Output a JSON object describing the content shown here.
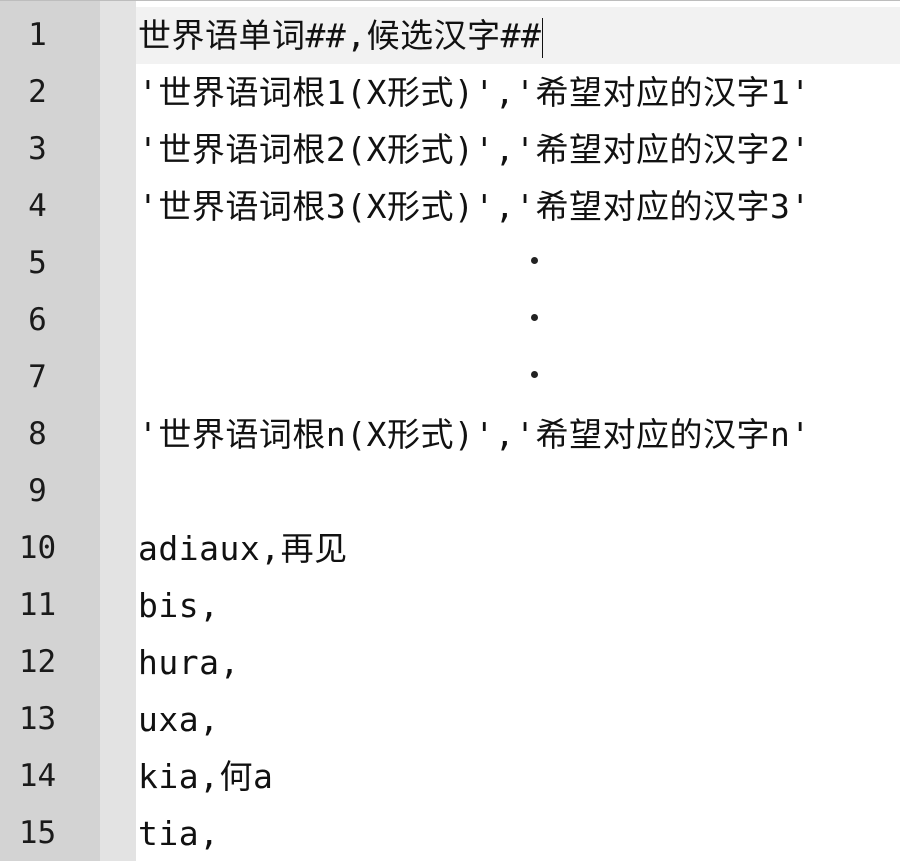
{
  "editor": {
    "lines": [
      {
        "number": "1",
        "text": "世界语单词##,候选汉字##"
      },
      {
        "number": "2",
        "text": "'世界语词根1(X形式)','希望对应的汉字1'"
      },
      {
        "number": "3",
        "text": "'世界语词根2(X形式)','希望对应的汉字2'"
      },
      {
        "number": "4",
        "text": "'世界语词根3(X形式)','希望对应的汉字3'"
      },
      {
        "number": "5",
        "text": ""
      },
      {
        "number": "6",
        "text": ""
      },
      {
        "number": "7",
        "text": ""
      },
      {
        "number": "8",
        "text": "'世界语词根n(X形式)','希望对应的汉字n'"
      },
      {
        "number": "9",
        "text": ""
      },
      {
        "number": "10",
        "text": "adiaux,再见"
      },
      {
        "number": "11",
        "text": "bis,"
      },
      {
        "number": "12",
        "text": "hura,"
      },
      {
        "number": "13",
        "text": "uxa,"
      },
      {
        "number": "14",
        "text": "kia,何a"
      },
      {
        "number": "15",
        "text": "tia,"
      }
    ],
    "current_line": 1
  }
}
